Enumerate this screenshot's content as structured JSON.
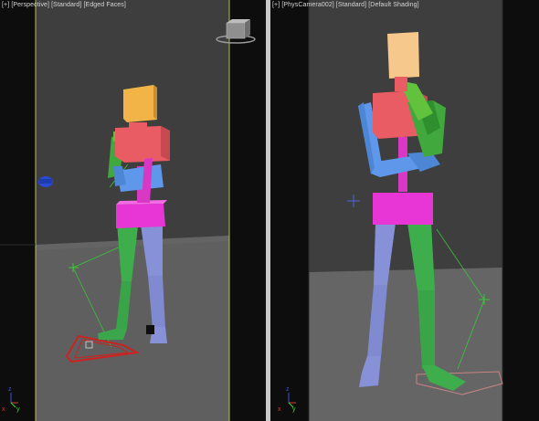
{
  "viewports": {
    "left": {
      "label_parts": [
        "[+]",
        "[Perspective]",
        "[Standard]",
        "[Edged Faces]"
      ]
    },
    "right": {
      "label_parts": [
        "[+]",
        "[PhysCamera002]",
        "[Standard]",
        "[Default Shading]"
      ]
    }
  },
  "gizmo": {
    "x_label": "x",
    "y_label": "y",
    "z_label": "z"
  },
  "colors": {
    "background_dark": "#0d0d0d",
    "wall": "#3e3e3e",
    "floor": "#5f5f5f",
    "frame_line": "#b7c04e",
    "head": "#f2b447",
    "head_right": "#f7c88b",
    "chest": "#ea5c63",
    "pelvis": "#e835d6",
    "spine": "#d938c4",
    "upper_arm_right": "#5f98ea",
    "forearm_right": "#4d86d4",
    "upper_arm_left": "#41a83e",
    "forearm_left": "#62c23d",
    "leg_left": "#3eae4d",
    "leg_right": "#8791d8",
    "footstep_red": "#cc2222",
    "ik_green": "#38c838",
    "helper_blue": "#2a4ad0"
  }
}
